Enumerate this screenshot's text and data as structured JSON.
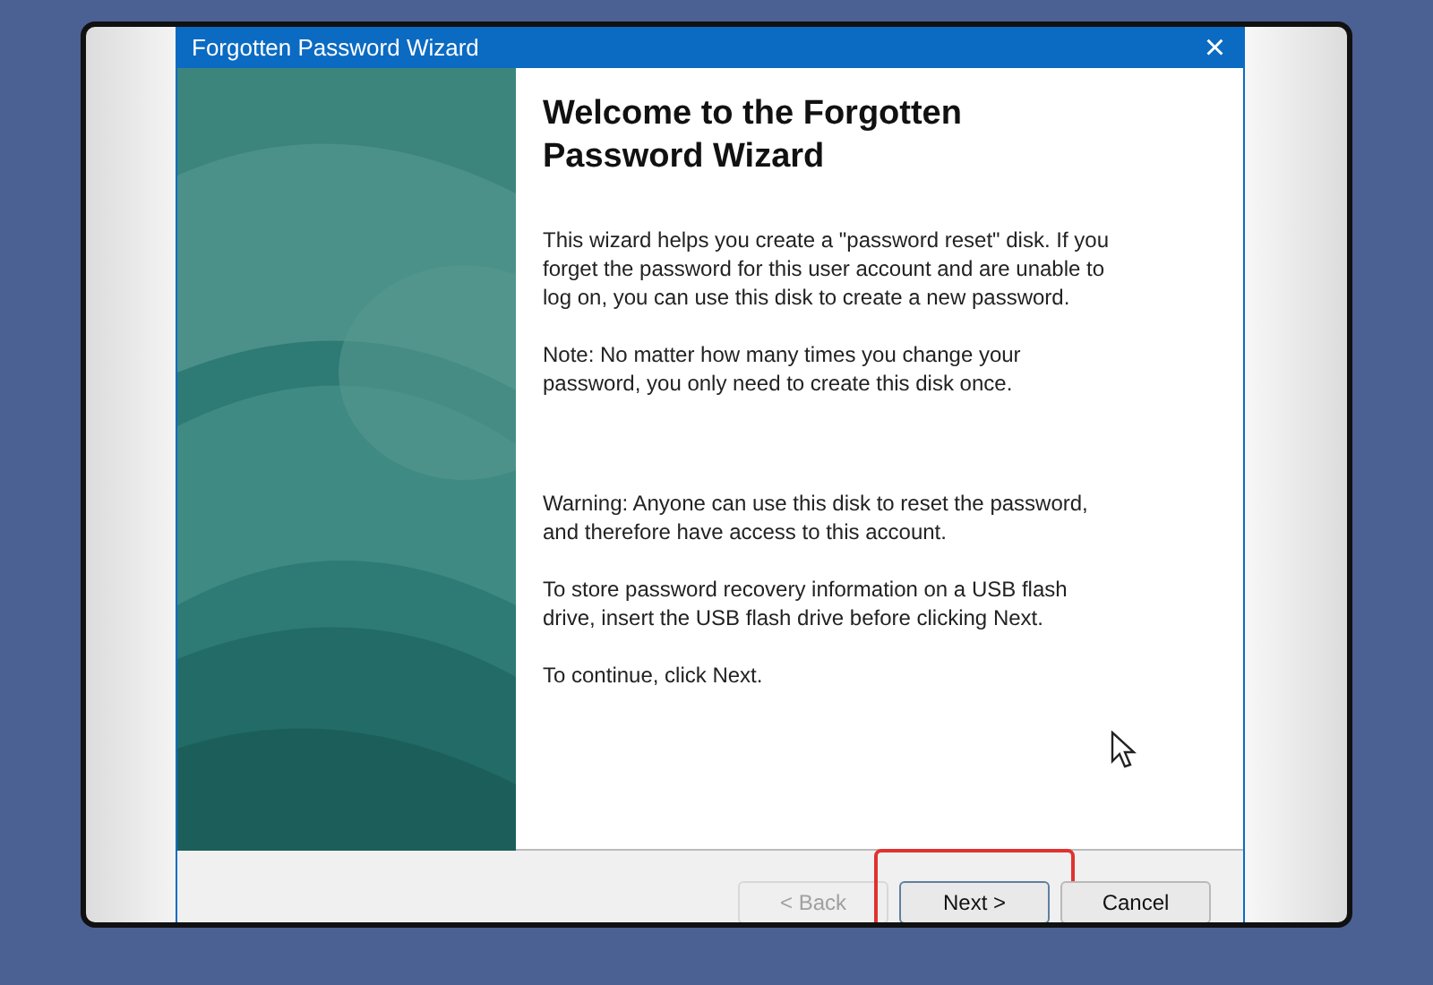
{
  "window": {
    "title": "Forgotten Password Wizard",
    "close": "×"
  },
  "side_panel": {
    "kind": "picture"
  },
  "heading": "Welcome to the Forgotten Password Wizard",
  "intro_paragraphs": [
    "This wizard helps you create a \"password reset\" disk. If you forget the password for this user account and are unable to log on, you can use this disk to create a new password.",
    "Note: No matter how many times you change your password, you only need to create this disk once."
  ],
  "notice_paragraphs": [
    "Warning: Anyone can use this disk to reset the password, and therefore have access to this account.",
    "To store password recovery information on a USB flash drive, insert the USB flash drive before clicking Next.",
    "To continue, click Next."
  ],
  "buttons": [
    {
      "label": "< Back",
      "disabled": true,
      "highlighted": false
    },
    {
      "label": "Next >",
      "disabled": false,
      "highlighted": true
    },
    {
      "label": "Cancel",
      "disabled": false,
      "highlighted": false
    }
  ]
}
